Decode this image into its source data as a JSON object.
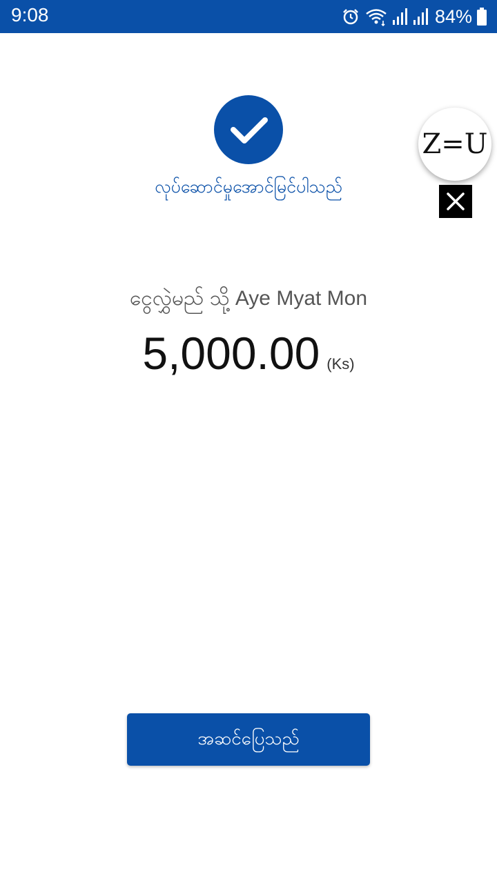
{
  "status_bar": {
    "time": "9:08",
    "battery_percent": "84%",
    "icons": [
      "alarm-icon",
      "wifi-icon",
      "signal-icon",
      "signal-icon",
      "battery-icon"
    ]
  },
  "result": {
    "icon": "checkmark-icon",
    "title": "လုပ်ဆောင်မှုအောင်မြင်ပါသည်"
  },
  "overlay": {
    "badge_text": "Z=U",
    "close_icon": "close-icon"
  },
  "transfer": {
    "recipient_text": "ငွေလွှဲမည် သို့ Aye Myat Mon",
    "amount": "5,000.00",
    "unit": "(Ks)"
  },
  "actions": {
    "done_label": "အဆင်ပြေသည်"
  },
  "colors": {
    "primary": "#0a50a8",
    "background": "#ffffff",
    "text": "#111111",
    "muted_text": "#555555"
  }
}
